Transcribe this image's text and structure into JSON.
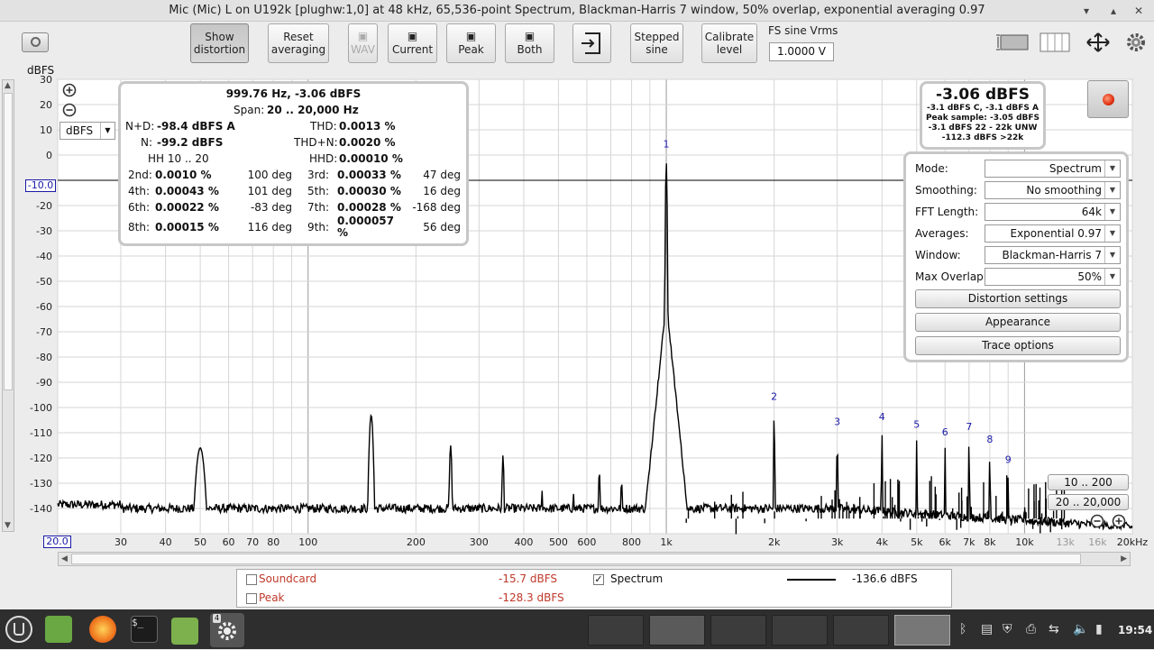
{
  "window": {
    "title": "Mic (Mic) L on U192k [plughw:1,0] at 48 kHz, 65,536-point Spectrum, Blackman-Harris 7 window, 50% overlap, exponential averaging 0.97",
    "min_glyph": "▾",
    "max_glyph": "▴",
    "close_glyph": "✕"
  },
  "toolbar": {
    "show_distortion": "Show distortion",
    "reset_averaging": "Reset averaging",
    "wav": "WAV",
    "current": "Current",
    "peak": "Peak",
    "both": "Both",
    "stepped_sine": "Stepped sine",
    "calibrate_level": "Calibrate level",
    "fs_label": "FS sine Vrms",
    "fs_value": "1.0000 V"
  },
  "plot": {
    "ylabel": "dBFS",
    "unit_select": "dBFS",
    "cursor_y_label": "-10.0",
    "x_start_label": "20.0"
  },
  "distortion": {
    "header": "999.76 Hz, -3.06 dBFS",
    "span_label": "Span:",
    "span_value": "20 .. 20,000 Hz",
    "npd_label": "N+D:",
    "npd_value": "-98.4 dBFS A",
    "n_label": "N:",
    "n_value": "-99.2 dBFS",
    "thd_label": "THD:",
    "thd_value": "0.0013 %",
    "thdn_label": "THD+N:",
    "thdn_value": "0.0020 %",
    "hh_label": "HH 10 .. 20",
    "hhd_label": "HHD:",
    "hhd_value": "0.00010 %",
    "harmonics": [
      {
        "label": "2nd:",
        "value": "0.0010 %",
        "phase": "100 deg"
      },
      {
        "label": "3rd:",
        "value": "0.00033 %",
        "phase": "47 deg"
      },
      {
        "label": "4th:",
        "value": "0.00043 %",
        "phase": "101 deg"
      },
      {
        "label": "5th:",
        "value": "0.00030 %",
        "phase": "16 deg"
      },
      {
        "label": "6th:",
        "value": "0.00022 %",
        "phase": "-83 deg"
      },
      {
        "label": "7th:",
        "value": "0.00028 %",
        "phase": "-168 deg"
      },
      {
        "label": "8th:",
        "value": "0.00015 %",
        "phase": "116 deg"
      },
      {
        "label": "9th:",
        "value": "0.000057 %",
        "phase": "56 deg"
      }
    ]
  },
  "level": {
    "main": "-3.06 dBFS",
    "lines": [
      "-3.1 dBFS C, -3.1 dBFS A",
      "Peak sample: -3.05 dBFS",
      "-3.1 dBFS 22 - 22k UNW",
      "-112.3 dBFS >22k"
    ]
  },
  "settings": {
    "rows": [
      {
        "label": "Mode:",
        "value": "Spectrum"
      },
      {
        "label": "Smoothing:",
        "value": "No  smoothing"
      },
      {
        "label": "FFT Length:",
        "value": "64k"
      },
      {
        "label": "Averages:",
        "value": "Exponential 0.97"
      },
      {
        "label": "Window:",
        "value": "Blackman-Harris 7"
      },
      {
        "label": "Max Overlap:",
        "value": "50%"
      }
    ],
    "buttons": [
      "Distortion settings",
      "Appearance",
      "Trace options"
    ],
    "dd_glyph": "▼"
  },
  "range": {
    "btn1": "10 .. 200",
    "btn2": "20 .. 20,000"
  },
  "legend": {
    "soundcard_label": "Soundcard",
    "soundcard_value": "-15.7 dBFS",
    "peak_label": "Peak",
    "peak_value": "-128.3 dBFS",
    "spectrum_label": "Spectrum",
    "spectrum_value": "-136.6 dBFS",
    "check_glyph": "✓"
  },
  "taskbar": {
    "clock": "19:54",
    "badge": "4"
  },
  "colors": {
    "accent_red": "#c0392b",
    "harmonic_blue": "#1a1aa8",
    "trace": "#000000",
    "taskbar_bg": "#2e2e2e"
  },
  "chart_data": {
    "type": "line",
    "series": [
      {
        "name": "Spectrum",
        "color": "#000000"
      }
    ],
    "xscale": "log",
    "xlim": [
      20,
      20000
    ],
    "ylim": [
      -150,
      30
    ],
    "x_ticks": [
      {
        "v": 30,
        "l": "30"
      },
      {
        "v": 40,
        "l": "40"
      },
      {
        "v": 50,
        "l": "50"
      },
      {
        "v": 60,
        "l": "60"
      },
      {
        "v": 70,
        "l": "70"
      },
      {
        "v": 80,
        "l": "80"
      },
      {
        "v": 100,
        "l": "100"
      },
      {
        "v": 200,
        "l": "200"
      },
      {
        "v": 300,
        "l": "300"
      },
      {
        "v": 400,
        "l": "400"
      },
      {
        "v": 500,
        "l": "500"
      },
      {
        "v": 600,
        "l": "600"
      },
      {
        "v": 800,
        "l": "800"
      },
      {
        "v": 1000,
        "l": "1k"
      },
      {
        "v": 2000,
        "l": "2k"
      },
      {
        "v": 3000,
        "l": "3k"
      },
      {
        "v": 4000,
        "l": "4k"
      },
      {
        "v": 5000,
        "l": "5k"
      },
      {
        "v": 6000,
        "l": "6k"
      },
      {
        "v": 7000,
        "l": "7k"
      },
      {
        "v": 8000,
        "l": "8k"
      },
      {
        "v": 10000,
        "l": "10k"
      },
      {
        "v": 13000,
        "l": "13k",
        "dim": true
      },
      {
        "v": 16000,
        "l": "16k",
        "dim": true
      },
      {
        "v": 20000,
        "l": "20kHz"
      }
    ],
    "y_ticks": [
      30,
      20,
      10,
      0,
      -20,
      -30,
      -40,
      -50,
      -60,
      -70,
      -80,
      -90,
      -100,
      -110,
      -120,
      -130,
      -140
    ],
    "noise_floor": -140,
    "peaks": [
      {
        "f": 50,
        "db": -116,
        "w": 0.018
      },
      {
        "f": 150,
        "db": -103,
        "w": 0.008
      },
      {
        "f": 250,
        "db": -115,
        "w": 0.005
      },
      {
        "f": 350,
        "db": -119,
        "w": 0.004
      },
      {
        "f": 450,
        "db": -133,
        "w": 0.003
      },
      {
        "f": 550,
        "db": -133,
        "w": 0.003
      },
      {
        "f": 650,
        "db": -124,
        "w": 0.003
      },
      {
        "f": 750,
        "db": -128,
        "w": 0.003
      },
      {
        "f": 1000,
        "db": -3.06,
        "w": 0.003
      },
      {
        "f": 2000,
        "db": -102,
        "w": 0.002
      },
      {
        "f": 3000,
        "db": -112,
        "w": 0.002
      },
      {
        "f": 4000,
        "db": -110,
        "w": 0.002
      },
      {
        "f": 5000,
        "db": -113,
        "w": 0.002
      },
      {
        "f": 6000,
        "db": -116,
        "w": 0.002
      },
      {
        "f": 7000,
        "db": -114,
        "w": 0.002
      },
      {
        "f": 8000,
        "db": -119,
        "w": 0.002
      },
      {
        "f": 9000,
        "db": -127,
        "w": 0.002
      },
      {
        "f": 10000,
        "db": -134,
        "w": 0.002
      }
    ],
    "harmonic_labels": [
      {
        "n": "1",
        "f": 1000,
        "db": 3
      },
      {
        "n": "2",
        "f": 2000,
        "db": -97
      },
      {
        "n": "3",
        "f": 3000,
        "db": -107
      },
      {
        "n": "4",
        "f": 4000,
        "db": -105
      },
      {
        "n": "5",
        "f": 5000,
        "db": -108
      },
      {
        "n": "6",
        "f": 6000,
        "db": -111
      },
      {
        "n": "7",
        "f": 7000,
        "db": -109
      },
      {
        "n": "8",
        "f": 8000,
        "db": -114
      },
      {
        "n": "9",
        "f": 9000,
        "db": -122
      }
    ],
    "cursor_db": -10
  }
}
